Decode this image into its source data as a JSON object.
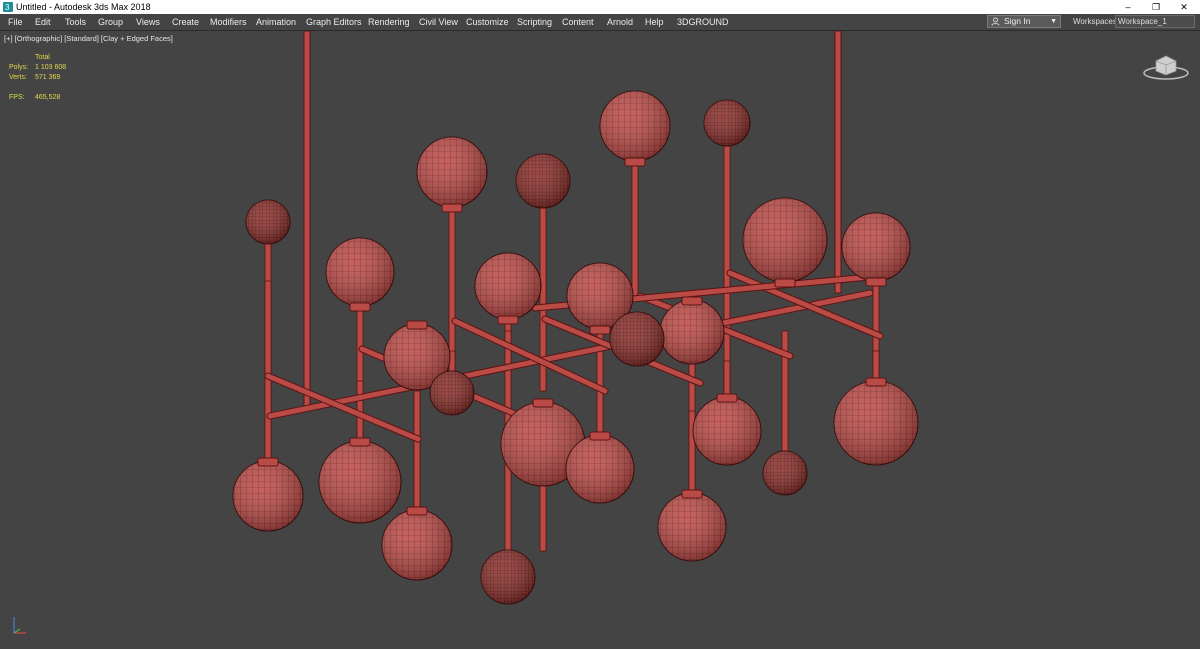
{
  "window": {
    "title": "Untitled - Autodesk 3ds Max 2018",
    "controls": [
      "–",
      "❐",
      "✕"
    ]
  },
  "menubar": {
    "items": [
      "File",
      "Edit",
      "Tools",
      "Group",
      "Views",
      "Create",
      "Modifiers",
      "Animation",
      "Graph Editors",
      "Rendering",
      "Civil View",
      "Customize",
      "Scripting",
      "Content",
      "Arnold",
      "Help",
      "3DGROUND"
    ],
    "sign_in": "Sign In",
    "workspaces_label": "Workspaces:",
    "workspace_value": "Workspace_1"
  },
  "viewport": {
    "label": "[+] [Orthographic] [Standard] [Clay + Edged Faces]",
    "stats": {
      "total_label": "Total",
      "polys_label": "Polys:",
      "polys_value": "1 103 608",
      "verts_label": "Verts:",
      "verts_value": "571 369",
      "fps_label": "FPS:",
      "fps_value": "465,528"
    }
  },
  "colors": {
    "viewport_bg": "#444444",
    "model_fill": "#b94a46",
    "model_wire": "#5a1412",
    "stats_text": "#e3d84b"
  },
  "icons": {
    "app": "3dsmax-logo-icon",
    "user": "user-icon",
    "viewcube": "viewcube-icon",
    "axis": "axis-tripod-icon"
  }
}
